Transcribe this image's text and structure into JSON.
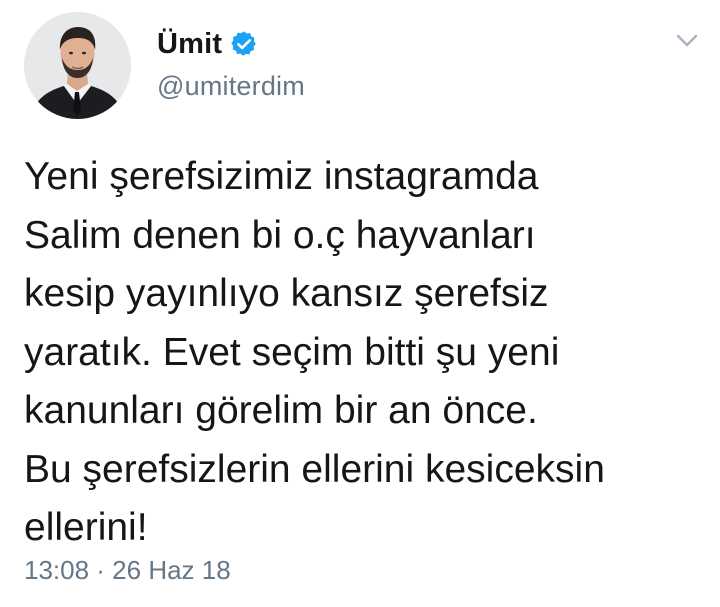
{
  "tweet": {
    "display_name": "Ümit",
    "handle": "@umiterdim",
    "verified": true,
    "verified_icon": "verified-badge-icon",
    "menu_icon": "chevron-down-icon",
    "avatar_icon": "profile-photo",
    "text": "Yeni şerefsizimiz instagramda\nSalim denen bi o.ç hayvanları\nkesip yayınlıyo kansız şerefsiz\nyaratık. Evet seçim bitti şu yeni\nkanunları görelim bir an önce.\nBu şerefsizlerin ellerini kesiceksin\nellerini!",
    "timestamp": "13:08 · 26 Haz 18"
  },
  "colors": {
    "text": "#14171a",
    "secondary": "#657786",
    "verified": "#1da1f2",
    "background": "#ffffff"
  }
}
